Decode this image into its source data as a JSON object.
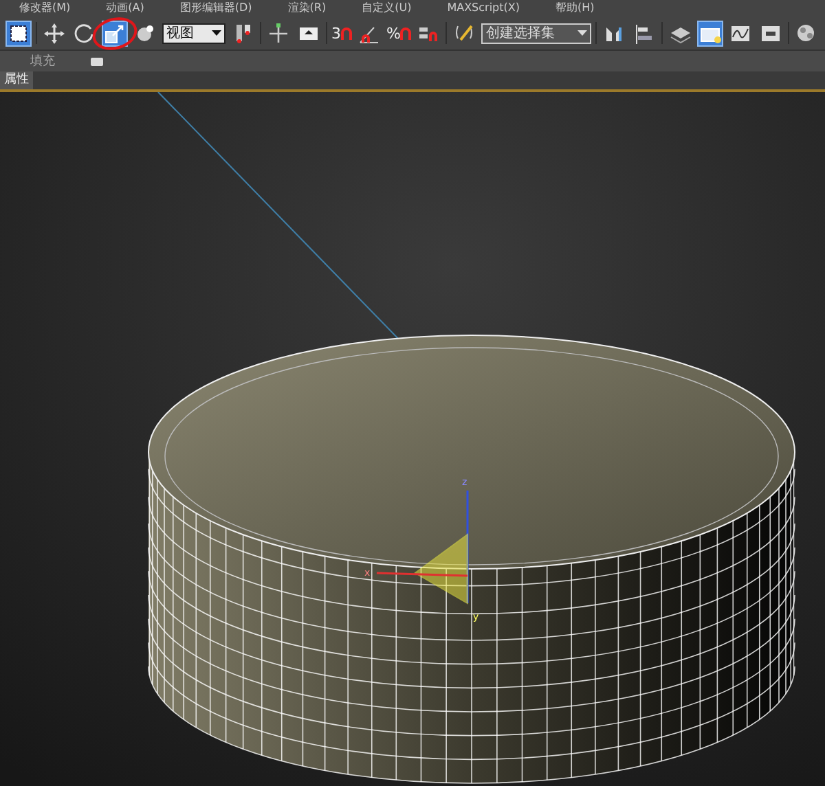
{
  "menu_bar": {
    "items": [
      "修改器(M)",
      "动画(A)",
      "图形编辑器(D)",
      "渲染(R)",
      "自定义(U)",
      "MAXScript(X)",
      "帮助(H)"
    ]
  },
  "toolbar": {
    "items": [
      {
        "kind": "tool",
        "selected": true
      },
      {
        "kind": "sep"
      },
      {
        "kind": "tool",
        "selected": false
      },
      {
        "kind": "tool",
        "selected": false
      },
      {
        "kind": "tool",
        "selected": true
      },
      {
        "kind": "tool",
        "selected": false
      },
      {
        "kind": "dropdown",
        "value": "视图"
      },
      {
        "kind": "tool",
        "selected": false
      },
      {
        "kind": "sep"
      },
      {
        "kind": "tool",
        "selected": false
      },
      {
        "kind": "tool",
        "selected": false
      },
      {
        "kind": "sep"
      },
      {
        "kind": "snap",
        "label": "3"
      },
      {
        "kind": "tool",
        "selected": false
      },
      {
        "kind": "snap",
        "label": "%"
      },
      {
        "kind": "tool",
        "selected": false
      },
      {
        "kind": "sep"
      },
      {
        "kind": "tool",
        "selected": false
      },
      {
        "kind": "dropdown",
        "value": "创建选择集"
      },
      {
        "kind": "sep"
      },
      {
        "kind": "tool",
        "selected": false
      },
      {
        "kind": "tool",
        "selected": false
      },
      {
        "kind": "sep"
      },
      {
        "kind": "tool",
        "selected": false
      },
      {
        "kind": "tool",
        "selected": true
      },
      {
        "kind": "tool",
        "selected": false
      },
      {
        "kind": "tool",
        "selected": false
      },
      {
        "kind": "sep"
      },
      {
        "kind": "tool",
        "selected": false
      }
    ]
  },
  "ribbon": {
    "label": "填充"
  },
  "panel_tabs": [
    {
      "label": "属性",
      "selected": true
    }
  ],
  "viewport": {
    "gizmo_axes": [
      "z",
      "x",
      "y"
    ]
  }
}
